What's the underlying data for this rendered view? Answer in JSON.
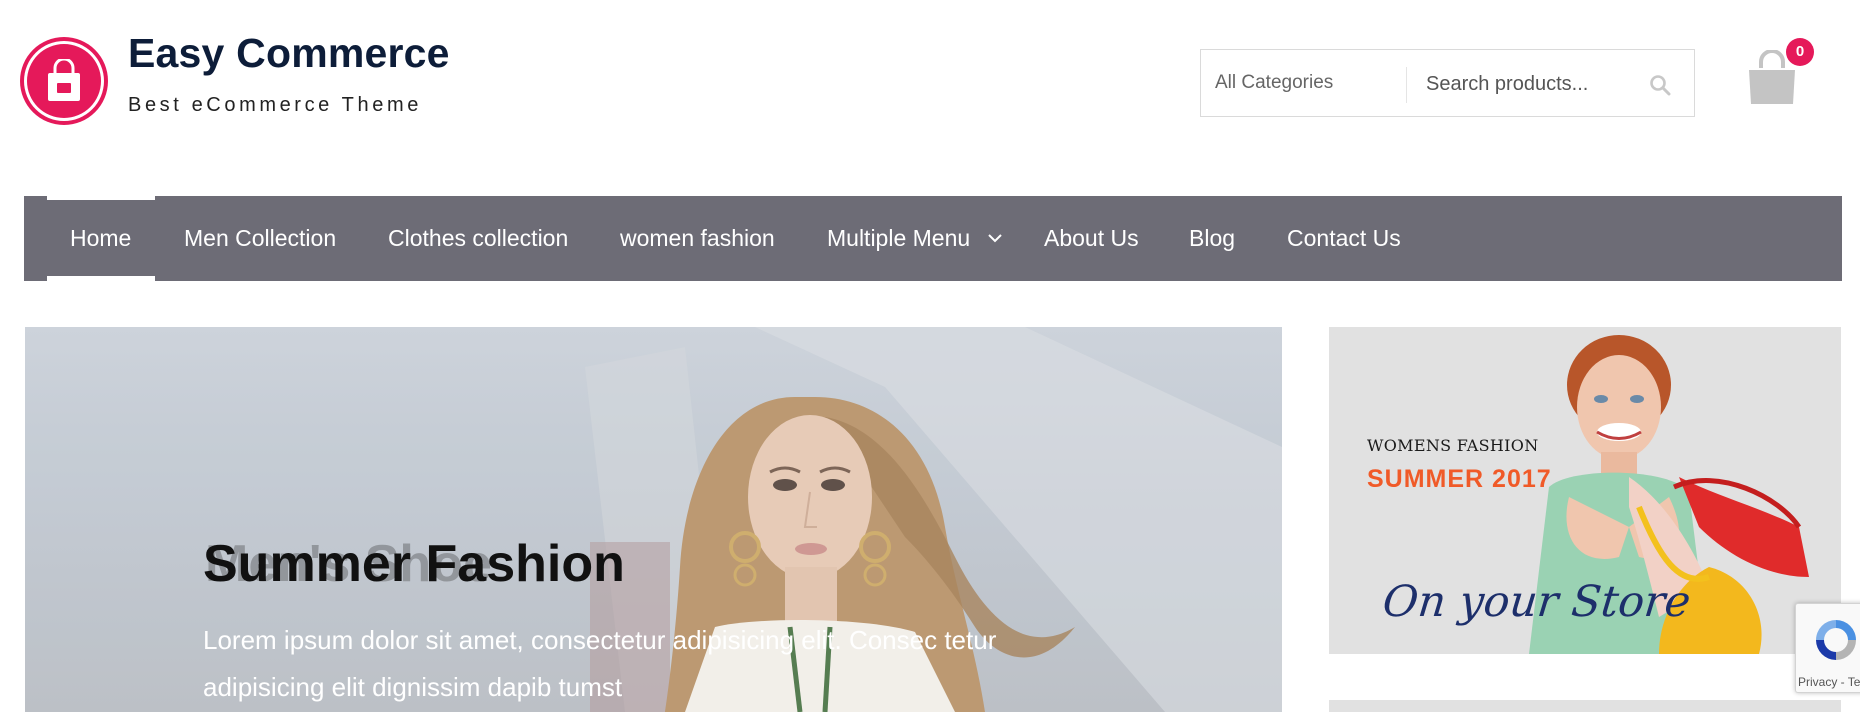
{
  "header": {
    "site_title": "Easy Commerce",
    "tagline": "Best eCommerce Theme",
    "logo_icon": "shopping-bag-icon",
    "search": {
      "category_value": "All Categories",
      "placeholder": "Search products...",
      "icon": "search-icon"
    },
    "cart": {
      "icon": "shopping-bag-icon",
      "count": "0"
    }
  },
  "nav": {
    "items": [
      {
        "label": "Home",
        "active": true
      },
      {
        "label": "Men Collection"
      },
      {
        "label": "Clothes collection"
      },
      {
        "label": "women fashion"
      },
      {
        "label": "Multiple Menu",
        "has_dropdown": true
      },
      {
        "label": "About Us"
      },
      {
        "label": "Blog"
      },
      {
        "label": "Contact Us"
      }
    ]
  },
  "hero": {
    "faded_title": "Men's Shoe",
    "title": "Summer Fashion",
    "text": "Lorem ipsum dolor sit amet, consectetur adipisicing elit. Consec tetur adipisicing elit dignissim dapib tumst"
  },
  "side_banner": {
    "kicker": "WOMENS FASHION",
    "headline": "SUMMER 2017",
    "script": "On your Store"
  },
  "recaptcha": {
    "text": "Privacy - Te"
  },
  "colors": {
    "accent": "#e5195a",
    "nav_background": "#6d6c76",
    "title": "#0d1d39",
    "banner_orange": "#f05a28",
    "banner_script": "#1d2f6b"
  }
}
